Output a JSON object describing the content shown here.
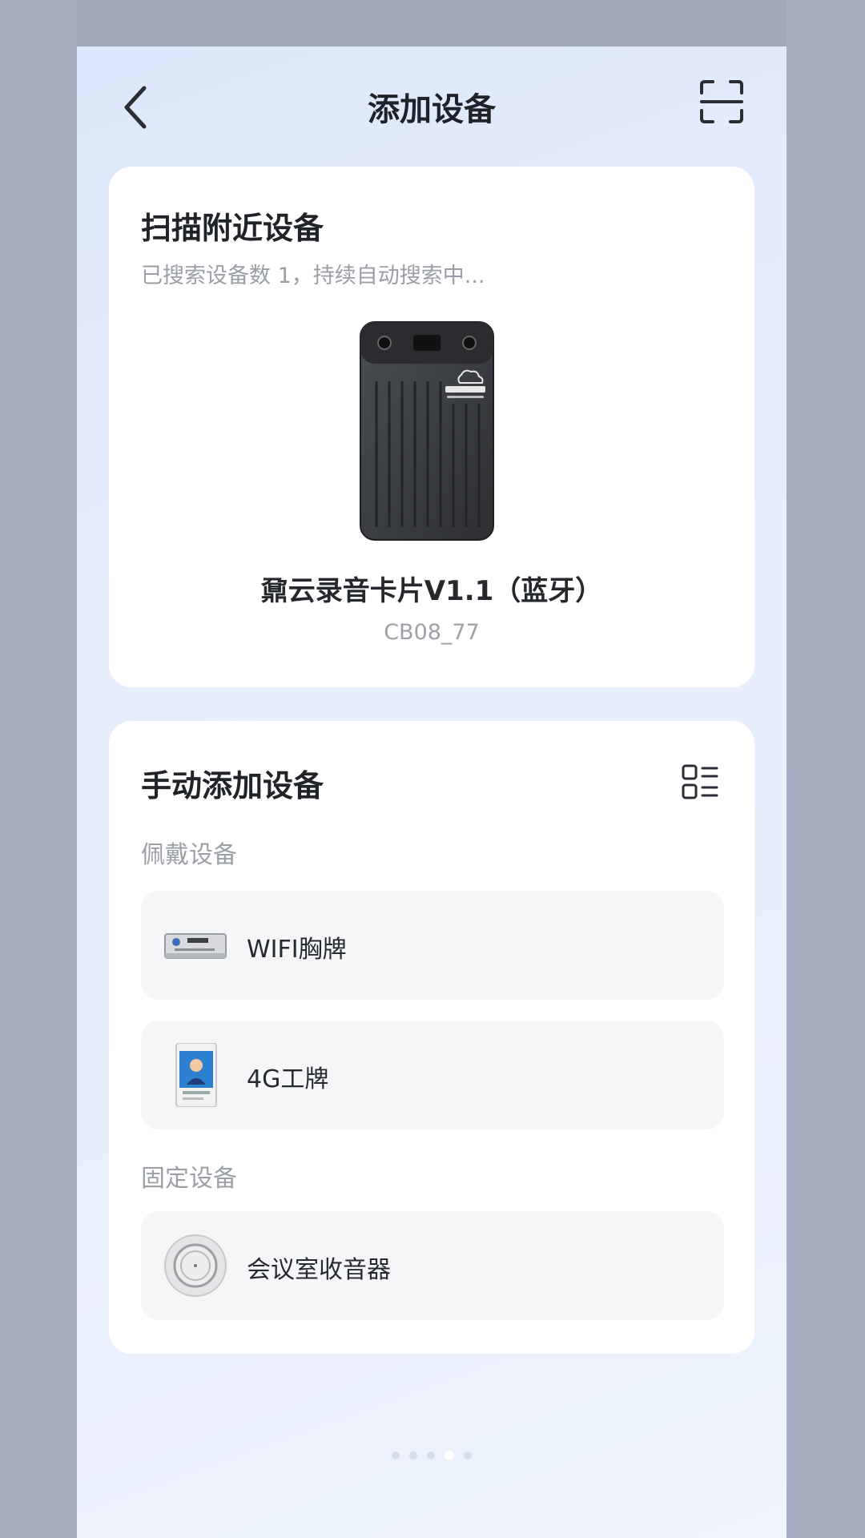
{
  "header": {
    "title": "添加设备"
  },
  "nearby": {
    "title": "扫描附近设备",
    "status": "已搜索设备数 1，持续自动搜索中...",
    "device": {
      "name": "鼐云录音卡片V1.1（蓝牙）",
      "id": "CB08_77"
    }
  },
  "manual": {
    "title": "手动添加设备",
    "sections": [
      {
        "label": "佩戴设备",
        "items": [
          {
            "label": "WIFI胸牌",
            "icon": "wifi-badge-thumbnail"
          },
          {
            "label": "4G工牌",
            "icon": "4g-badge-thumbnail"
          }
        ]
      },
      {
        "label": "固定设备",
        "items": [
          {
            "label": "会议室收音器",
            "icon": "meeting-room-receiver-thumbnail"
          }
        ]
      }
    ]
  },
  "pager": {
    "count": 5,
    "active_index": 3
  }
}
